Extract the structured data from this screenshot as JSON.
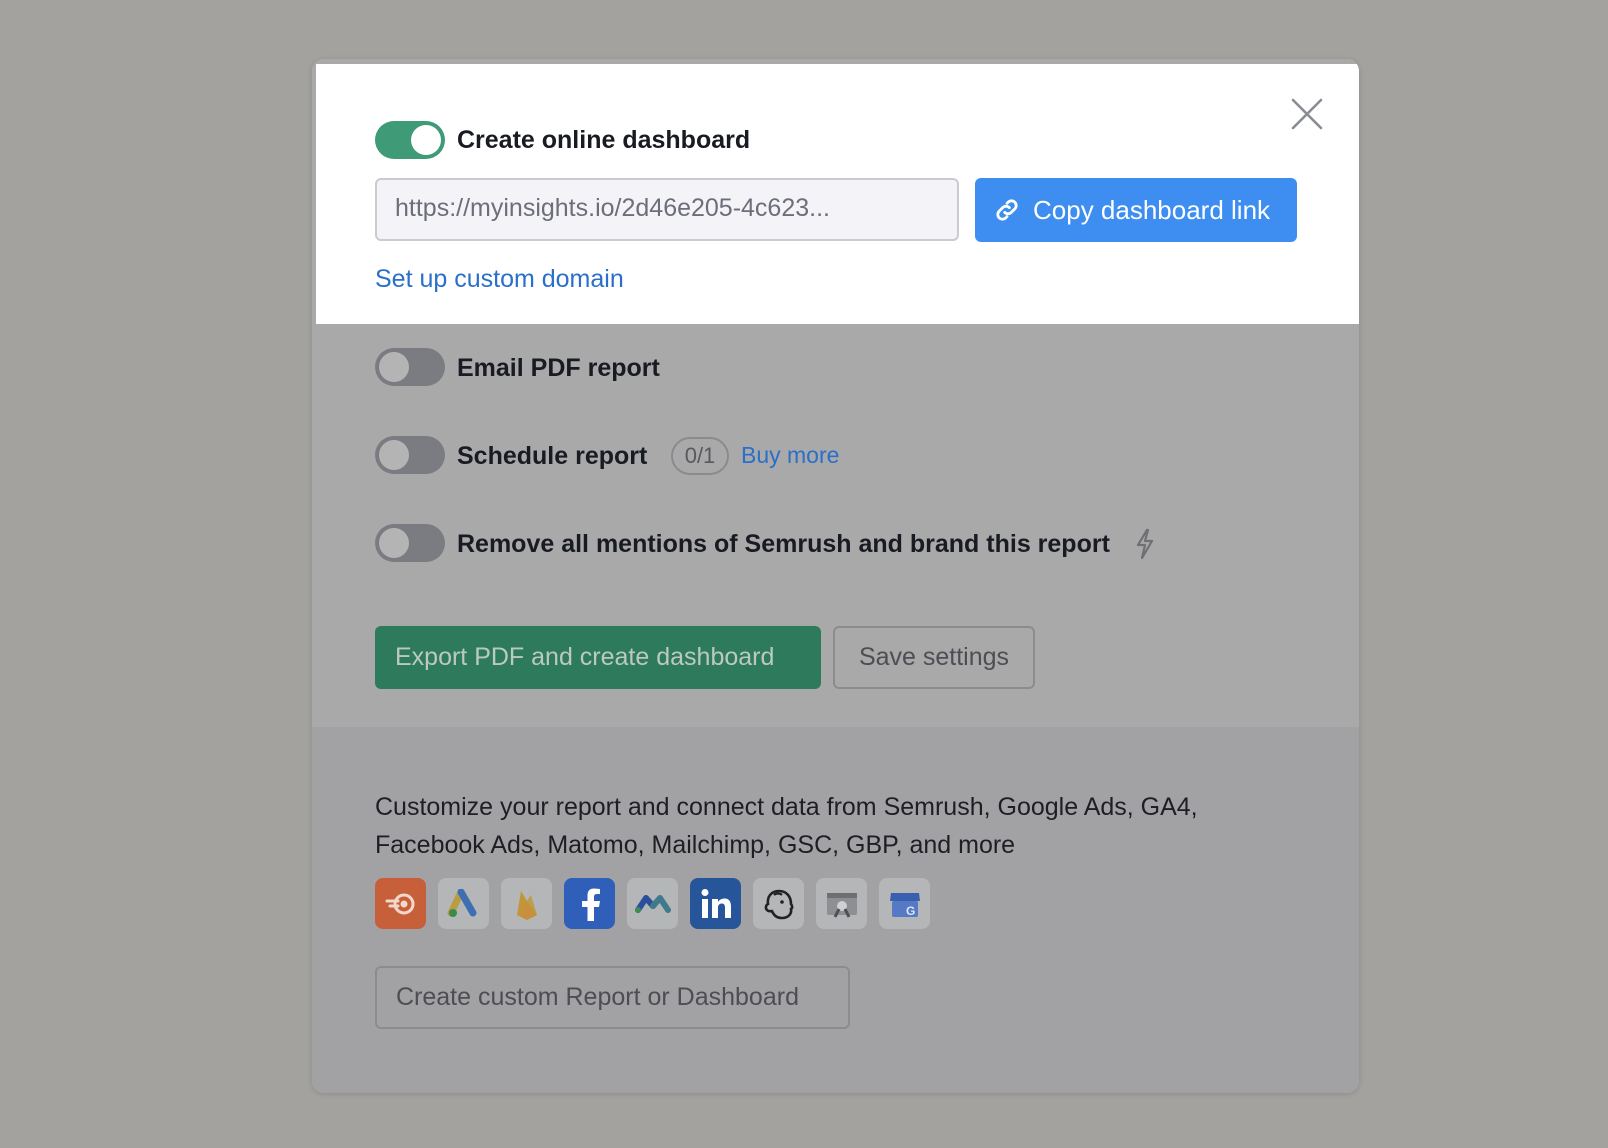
{
  "dashboard": {
    "toggle_state": "on",
    "title": "Create online dashboard",
    "url_value": "https://myinsights.io/2d46e205-4c623...",
    "copy_button": "Copy dashboard link",
    "custom_domain_link": "Set up custom domain"
  },
  "options": {
    "email_pdf": {
      "label": "Email PDF report",
      "toggle_state": "off"
    },
    "schedule": {
      "label": "Schedule report",
      "toggle_state": "off",
      "badge": "0/1",
      "buy_more": "Buy more"
    },
    "branding": {
      "label": "Remove all mentions of Semrush and brand this report",
      "toggle_state": "off",
      "icon": "lightning-icon"
    }
  },
  "actions": {
    "export": "Export PDF and create dashboard",
    "save": "Save settings"
  },
  "footer": {
    "text": "Customize your report and connect data from Semrush, Google Ads, GA4, Facebook Ads, Matomo, Mailchimp, GSC, GBP, and more",
    "integrations": [
      "semrush-icon",
      "google-ads-icon",
      "firebase-icon",
      "facebook-icon",
      "matomo-icon",
      "linkedin-icon",
      "mailchimp-icon",
      "search-console-icon",
      "google-business-profile-icon"
    ],
    "custom_button": "Create custom Report or Dashboard"
  },
  "colors": {
    "toggle_on": "#3f9a78",
    "primary_blue": "#3d8ef0",
    "export_green": "#2d7a5d",
    "link": "#2a6fc9"
  }
}
